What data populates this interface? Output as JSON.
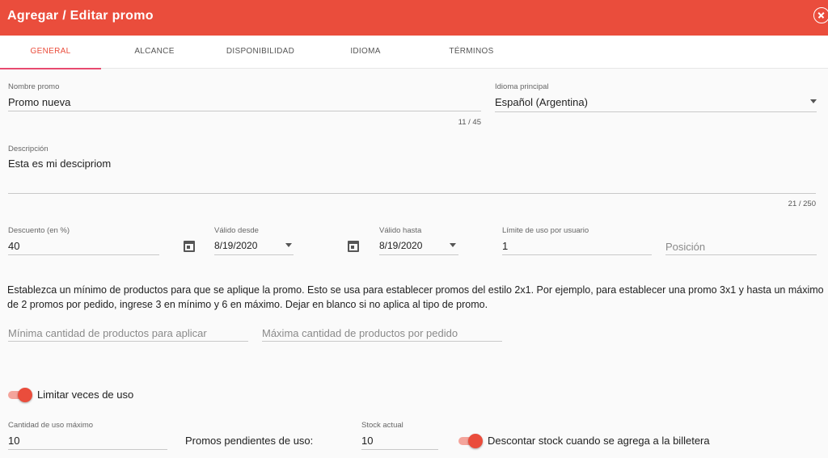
{
  "header": {
    "title": "Agregar / Editar promo",
    "close_icon": "close-circle-icon"
  },
  "tabs": [
    {
      "label": "GENERAL",
      "active": true
    },
    {
      "label": "ALCANCE",
      "active": false
    },
    {
      "label": "DISPONIBILIDAD",
      "active": false
    },
    {
      "label": "IDIOMA",
      "active": false
    },
    {
      "label": "TÉRMINOS",
      "active": false
    }
  ],
  "accent_color": "#ea4d3c",
  "form": {
    "nombre": {
      "label": "Nombre promo",
      "value": "Promo nueva",
      "counter": "11 / 45"
    },
    "idioma": {
      "label": "Idioma principal",
      "value": "Español (Argentina)"
    },
    "descripcion": {
      "label": "Descripción",
      "value": "Esta es mi descipriom",
      "counter": "21 / 250"
    },
    "descuento": {
      "label": "Descuento (en %)",
      "value": "40"
    },
    "valido_desde": {
      "label": "Válido desde",
      "value": "8/19/2020"
    },
    "valido_hasta": {
      "label": "Válido hasta",
      "value": "8/19/2020"
    },
    "limite_usuario": {
      "label": "Límite de uso por usuario",
      "value": "1"
    },
    "posicion": {
      "placeholder": "Posición"
    },
    "info_text": "Establezca un mínimo de productos para que se aplique la promo. Esto se usa para establecer promos del estilo 2x1. Por ejemplo, para establecer una promo 3x1 y hasta un máximo de 2 promos por pedido, ingrese 3 en mínimo y 6 en máximo. Dejar en blanco si no aplica al tipo de promo.",
    "minima": {
      "placeholder": "Mínima cantidad de productos para aplicar"
    },
    "maxima": {
      "placeholder": "Máxima cantidad de productos por pedido"
    },
    "limitar_toggle": {
      "label": "Limitar veces de uso",
      "checked": true
    },
    "cantidad_max": {
      "label": "Cantidad de uso máximo",
      "value": "10"
    },
    "pendientes": {
      "label": "Promos pendientes de uso:"
    },
    "stock": {
      "label": "Stock actual",
      "value": "10"
    },
    "descontar_toggle": {
      "label": "Descontar stock cuando se agrega a la billetera",
      "checked": true
    }
  }
}
